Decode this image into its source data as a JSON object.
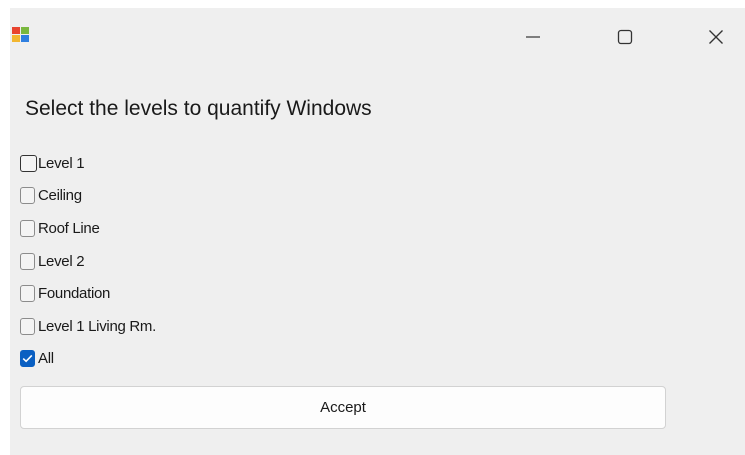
{
  "window": {
    "icon": "app-icon",
    "controls": {
      "minimize_icon": "minimize-icon",
      "maximize_icon": "maximize-icon",
      "close_icon": "close-icon"
    }
  },
  "prompt": "Select the levels to quantify Windows",
  "levels": [
    {
      "label": "Level 1",
      "checked": false
    },
    {
      "label": "Ceiling",
      "checked": false
    },
    {
      "label": "Roof Line",
      "checked": false
    },
    {
      "label": "Level 2",
      "checked": false
    },
    {
      "label": "Foundation",
      "checked": false
    },
    {
      "label": "Level 1 Living Rm.",
      "checked": false
    },
    {
      "label": "All",
      "checked": true
    }
  ],
  "accept_label": "Accept",
  "colors": {
    "window_bg": "#efefef",
    "checkbox_checked": "#0a5fc2",
    "text": "#1a1a1a"
  }
}
